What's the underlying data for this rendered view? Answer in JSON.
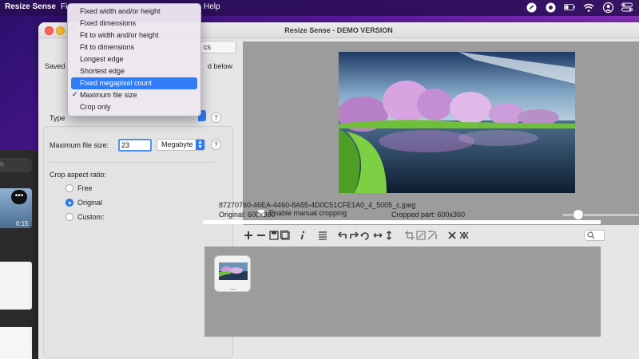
{
  "menubar": {
    "app_name": "Resize Sense",
    "file_fragment": "Fi",
    "help_label": "Help"
  },
  "window": {
    "title": "Resize Sense - DEMO VERSION"
  },
  "left_panel": {
    "tab_fragment": "cs",
    "saved_label": "Saved",
    "d_below_label": "d below",
    "type_label": "Type",
    "help_symbol": "?",
    "max_file_size_label": "Maximum file size:",
    "max_file_size_value": "23",
    "unit_value": "Megabyte",
    "crop_aspect_label": "Crop aspect ratio:",
    "crop_options": [
      {
        "label": "Free",
        "selected": false
      },
      {
        "label": "Original",
        "selected": true
      },
      {
        "label": "Custom:",
        "selected": false
      }
    ]
  },
  "popup_menu": {
    "items": [
      {
        "label": "Fixed width and/or height",
        "checked": false,
        "highlighted": false
      },
      {
        "label": "Fixed dimensions",
        "checked": false,
        "highlighted": false
      },
      {
        "label": "Fit to width and/or height",
        "checked": false,
        "highlighted": false
      },
      {
        "label": "Fit to dimensions",
        "checked": false,
        "highlighted": false
      },
      {
        "label": "Longest edge",
        "checked": false,
        "highlighted": false
      },
      {
        "label": "Shortest edge",
        "checked": false,
        "highlighted": false
      },
      {
        "label": "Fixed megapixel count",
        "checked": false,
        "highlighted": true
      },
      {
        "label": "Maximum file size",
        "checked": true,
        "highlighted": false
      },
      {
        "label": "Crop only",
        "checked": false,
        "highlighted": false
      }
    ]
  },
  "preview": {
    "enable_manual_cropping_label": "Enable manual cropping",
    "filename": "87270760-46EA-4460-8A55-4D0C51CFE1A0_4_5005_c.jpeg",
    "original_size": "Original: 600x360",
    "cropped_size": "Cropped part: 600x360"
  },
  "thumbnails": {
    "caption": "..."
  },
  "background_window": {
    "search_fragment": "h",
    "more_symbol": "•••",
    "duration": "0:15"
  },
  "colors": {
    "accent": "#2f7cf6",
    "window_bg": "#e6e6e6",
    "canvas_bg": "#9c9c9c"
  }
}
